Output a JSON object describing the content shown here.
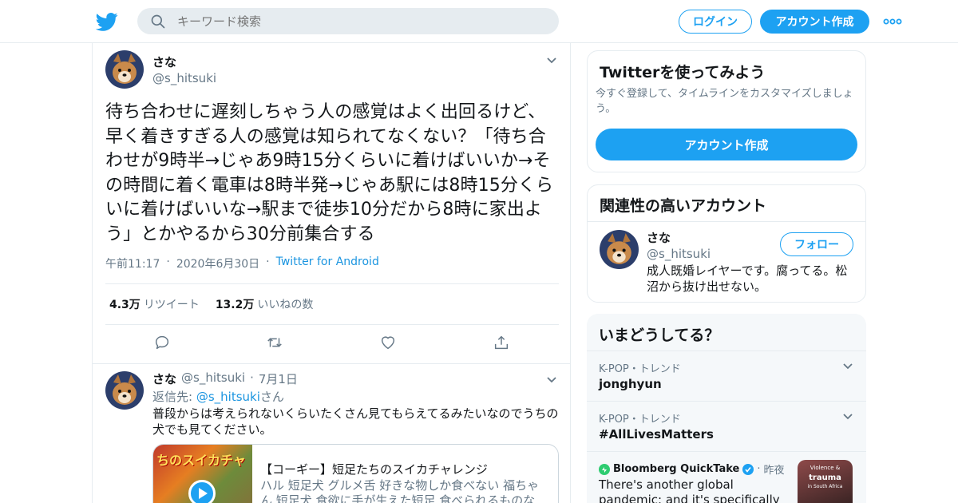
{
  "header": {
    "search_placeholder": "キーワード検索",
    "login_label": "ログイン",
    "signup_label": "アカウント作成"
  },
  "tweet": {
    "display_name": "さな",
    "handle": "@s_hitsuki",
    "text": "待ち合わせに遅刻しちゃう人の感覚はよく出回るけど、早く着きすぎる人の感覚は知られてなくない？「待ち合わせが9時半→じゃあ9時15分くらいに着けばいいか→その時間に着く電車は8時半発→じゃあ駅には8時15分くらいに着けばいいな→駅まで徒歩10分だから8時に家出よう」とかやるから30分前集合する",
    "time": "午前11:17",
    "date": "2020年6月30日",
    "source": "Twitter for Android",
    "retweet_count": "4.3万",
    "retweet_label": "リツイート",
    "like_count": "13.2万",
    "like_label": "いいねの数"
  },
  "reply": {
    "display_name": "さな",
    "handle": "@s_hitsuki",
    "date": "7月1日",
    "reply_to_prefix": "返信先:",
    "reply_to_handle": "@s_hitsuki",
    "reply_to_suffix": "さん",
    "text": "普段からは考えられないくらいたくさん見てもらえてるみたいなのでうちの犬でも見てください。",
    "card": {
      "image_text": "ちのスイカチャ",
      "title": "【コーギー】短足たちのスイカチャレンジ",
      "description": "ハル 短足犬 グルメ舌 好きな物しか食べない 福ちゃん 短足犬 食欲に手が生えた短足 食べられるものな"
    }
  },
  "sidebar": {
    "signup_box": {
      "title": "Twitterを使ってみよう",
      "subtitle": "今すぐ登録して、タイムラインをカスタマイズしましょう。",
      "button_label": "アカウント作成"
    },
    "related": {
      "title": "関連性の高いアカウント",
      "display_name": "さな",
      "handle": "@s_hitsuki",
      "follow_label": "フォロー",
      "bio": "成人既婚レイヤーです。腐ってる。松沼から抜け出せない。"
    },
    "trends": {
      "title": "いまどうしてる？",
      "items": [
        {
          "category": "K-POP・トレンド",
          "name": "jonghyun"
        },
        {
          "category": "K-POP・トレンド",
          "name": "#AllLivesMatters"
        }
      ],
      "news": {
        "source": "Bloomberg QuickTake",
        "time": "昨夜",
        "text": "There's another global pandemic: and it's specifically affecting women",
        "thumb_line1": "Violence &",
        "thumb_line2": "trauma",
        "thumb_line3": "in South Africa"
      }
    }
  },
  "colors": {
    "accent": "#1da1f2",
    "link": "#1b95e0",
    "secondary_text": "#657786",
    "border": "#e6ecf0",
    "trend_bg": "#f5f8fa"
  }
}
